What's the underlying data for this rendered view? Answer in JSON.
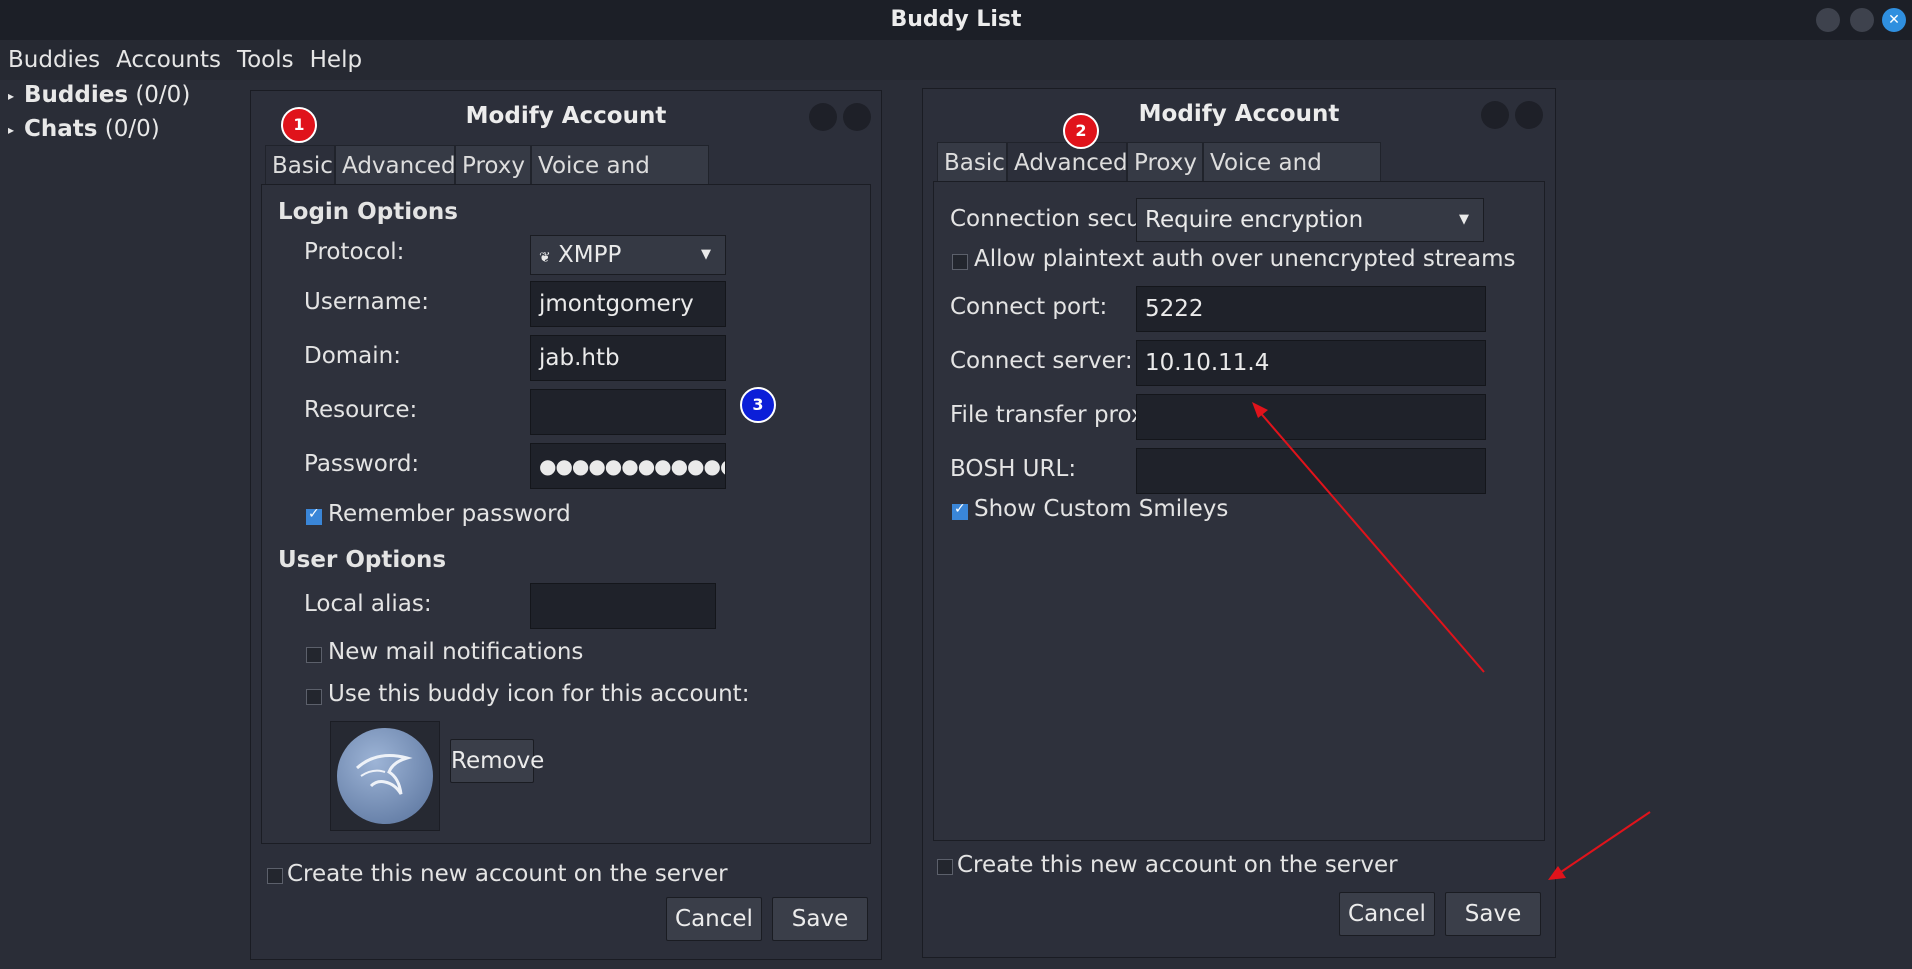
{
  "window": {
    "title": "Buddy List"
  },
  "menu": [
    "Buddies",
    "Accounts",
    "Tools",
    "Help"
  ],
  "tree": [
    {
      "name": "Buddies",
      "count": "(0/0)"
    },
    {
      "name": "Chats",
      "count": "(0/0)"
    }
  ],
  "left_dialog": {
    "title": "Modify Account",
    "tabs": [
      "Basic",
      "Advanced",
      "Proxy",
      "Voice and Video"
    ],
    "active_tab": "Basic",
    "login_heading": "Login Options",
    "protocol_label": "Protocol:",
    "protocol_value": "XMPP",
    "username_label": "Username:",
    "username_value": "jmontgomery",
    "domain_label": "Domain:",
    "domain_value": "jab.htb",
    "resource_label": "Resource:",
    "resource_value": "",
    "password_label": "Password:",
    "password_value": "●●●●●●●●●●●●",
    "remember_label": "Remember password",
    "remember_checked": true,
    "user_heading": "User Options",
    "alias_label": "Local alias:",
    "alias_value": "",
    "mail_label": "New mail notifications",
    "mail_checked": false,
    "buddy_icon_label": "Use this buddy icon for this account:",
    "buddy_icon_checked": false,
    "remove_label": "Remove",
    "create_label": "Create this new account on the server",
    "create_checked": false,
    "cancel_label": "Cancel",
    "save_label": "Save"
  },
  "right_dialog": {
    "title": "Modify Account",
    "tabs": [
      "Basic",
      "Advanced",
      "Proxy",
      "Voice and Video"
    ],
    "active_tab": "Advanced",
    "security_label": "Connection security:",
    "security_value": "Require encryption",
    "plaintext_label": "Allow plaintext auth over unencrypted streams",
    "plaintext_checked": false,
    "port_label": "Connect port:",
    "port_value": "5222",
    "server_label": "Connect server:",
    "server_value": "10.10.11.4",
    "proxies_label": "File transfer proxies:",
    "proxies_value": "",
    "bosh_label": "BOSH URL:",
    "bosh_value": "",
    "smileys_label": "Show Custom Smileys",
    "smileys_checked": true,
    "create_label": "Create this new account on the server",
    "create_checked": false,
    "cancel_label": "Cancel",
    "save_label": "Save"
  },
  "annotations": {
    "badge1": "1",
    "badge2": "2",
    "badge3": "3",
    "arrow_color": "#e0131b"
  },
  "colors": {
    "background": "#2a2d37",
    "accent": "#3a86d8"
  }
}
